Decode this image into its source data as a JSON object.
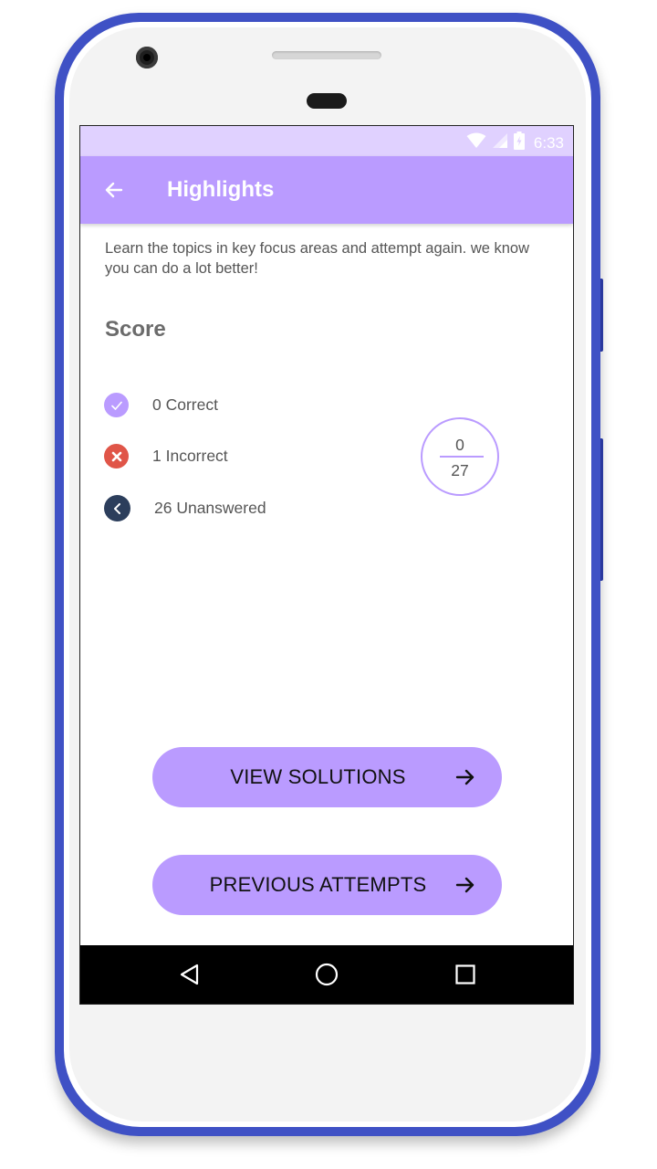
{
  "status_bar": {
    "time": "6:33",
    "background": "#e0d1ff",
    "icons": [
      "wifi-icon",
      "cell-signal-icon",
      "battery-icon"
    ]
  },
  "app_bar": {
    "title": "Highlights",
    "background": "#ba9bff",
    "back_icon": "arrow-back-icon"
  },
  "intro": {
    "text": "Learn the topics in key focus areas and attempt again. we know you can do a lot better!"
  },
  "score": {
    "heading": "Score",
    "items": [
      {
        "label": "0 Correct",
        "icon": "check-circle-icon",
        "color": "#ba9bff"
      },
      {
        "label": "1 Incorrect",
        "icon": "cross-circle-icon",
        "color": "#e05548"
      },
      {
        "label": "26 Unanswered",
        "icon": "chevron-left-circle-icon",
        "color": "#2c3e5c"
      }
    ],
    "fraction": {
      "numerator": "0",
      "denominator": "27"
    }
  },
  "actions": {
    "view_solutions": "VIEW SOLUTIONS",
    "previous_attempts": "PREVIOUS ATTEMPTS",
    "arrow_icon": "arrow-forward-icon"
  },
  "nav_bar": {
    "icons": [
      "back-triangle-icon",
      "home-circle-icon",
      "recents-square-icon"
    ]
  },
  "colors": {
    "accent": "#ba9bff",
    "frame": "#3f51c5",
    "text": "#555555"
  }
}
